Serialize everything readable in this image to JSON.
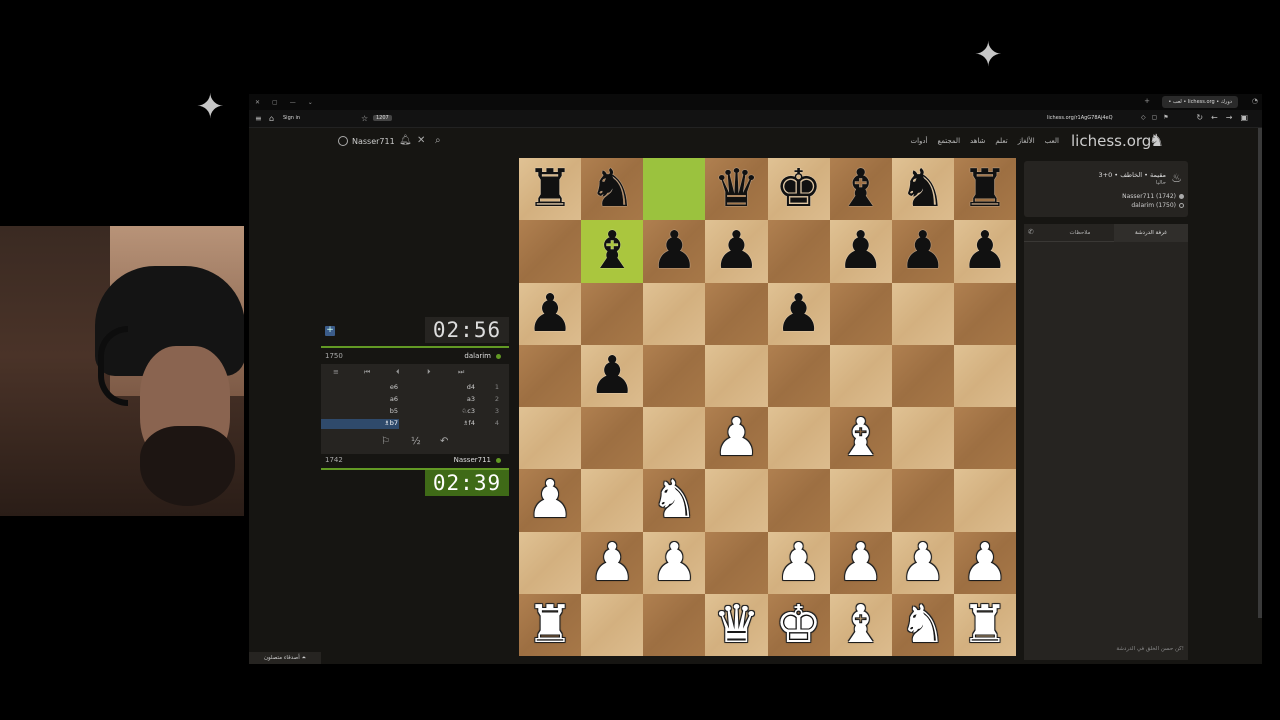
{
  "browser": {
    "tab_title": "• لعب • lichess.org • دورك",
    "address_url": "lichess.org/r1AgG78Aj4eQ",
    "sign_in": "Sign in",
    "badge": "1207"
  },
  "site": {
    "logo": "lichess.org",
    "username": "Nasser711",
    "nav": [
      "العب",
      "الألغاز",
      "تعلم",
      "شاهد",
      "المجتمع",
      "أدوات"
    ]
  },
  "game_info": {
    "title": "3+0 • مقيمة • الخاطف",
    "subtitle": "حاليا",
    "player_white": "Nasser711 (1742)",
    "player_black": "dalarim (1750)"
  },
  "chat": {
    "tab_room": "غرفة الدردشة",
    "tab_notes": "ملاحظات",
    "input_placeholder": "كن حسن الخلق في الدردشة!"
  },
  "clock_top": "02:56",
  "clock_bottom": "02:39",
  "player_top": {
    "name": "dalarim",
    "rating": "1750"
  },
  "player_bottom": {
    "name": "Nasser711",
    "rating": "1742"
  },
  "moves": [
    {
      "num": "1",
      "white": "d4",
      "black": "e6"
    },
    {
      "num": "2",
      "white": "a3",
      "black": "a6"
    },
    {
      "num": "3",
      "white": "♘c3",
      "black": "b5"
    },
    {
      "num": "4",
      "white": "♗f4",
      "black": "♗b7"
    }
  ],
  "move_actions": {
    "flag": "⚐",
    "draw": "½",
    "takeback": "↶"
  },
  "friends_bar": "أصدقاء متصلون ⏶",
  "board": [
    [
      "bR",
      "bN",
      "",
      "bQ",
      "bK",
      "bB",
      "bN",
      "bR"
    ],
    [
      "",
      "bB",
      "bP",
      "bP",
      "",
      "bP",
      "bP",
      "bP"
    ],
    [
      "bP",
      "",
      "",
      "",
      "bP",
      "",
      "",
      ""
    ],
    [
      "",
      "bP",
      "",
      "",
      "",
      "",
      "",
      ""
    ],
    [
      "",
      "",
      "",
      "wP",
      "",
      "wB",
      "",
      ""
    ],
    [
      "wP",
      "",
      "wN",
      "",
      "",
      "",
      "",
      ""
    ],
    [
      "",
      "wP",
      "wP",
      "",
      "wP",
      "wP",
      "wP",
      "wP"
    ],
    [
      "wR",
      "",
      "",
      "wQ",
      "wK",
      "wB",
      "wN",
      "wR"
    ]
  ],
  "highlights": [
    "r0c2",
    "r1c1"
  ],
  "colors": {
    "clock_active": "#3f6a17",
    "online": "#629924",
    "highlight": "#9bc23e"
  }
}
